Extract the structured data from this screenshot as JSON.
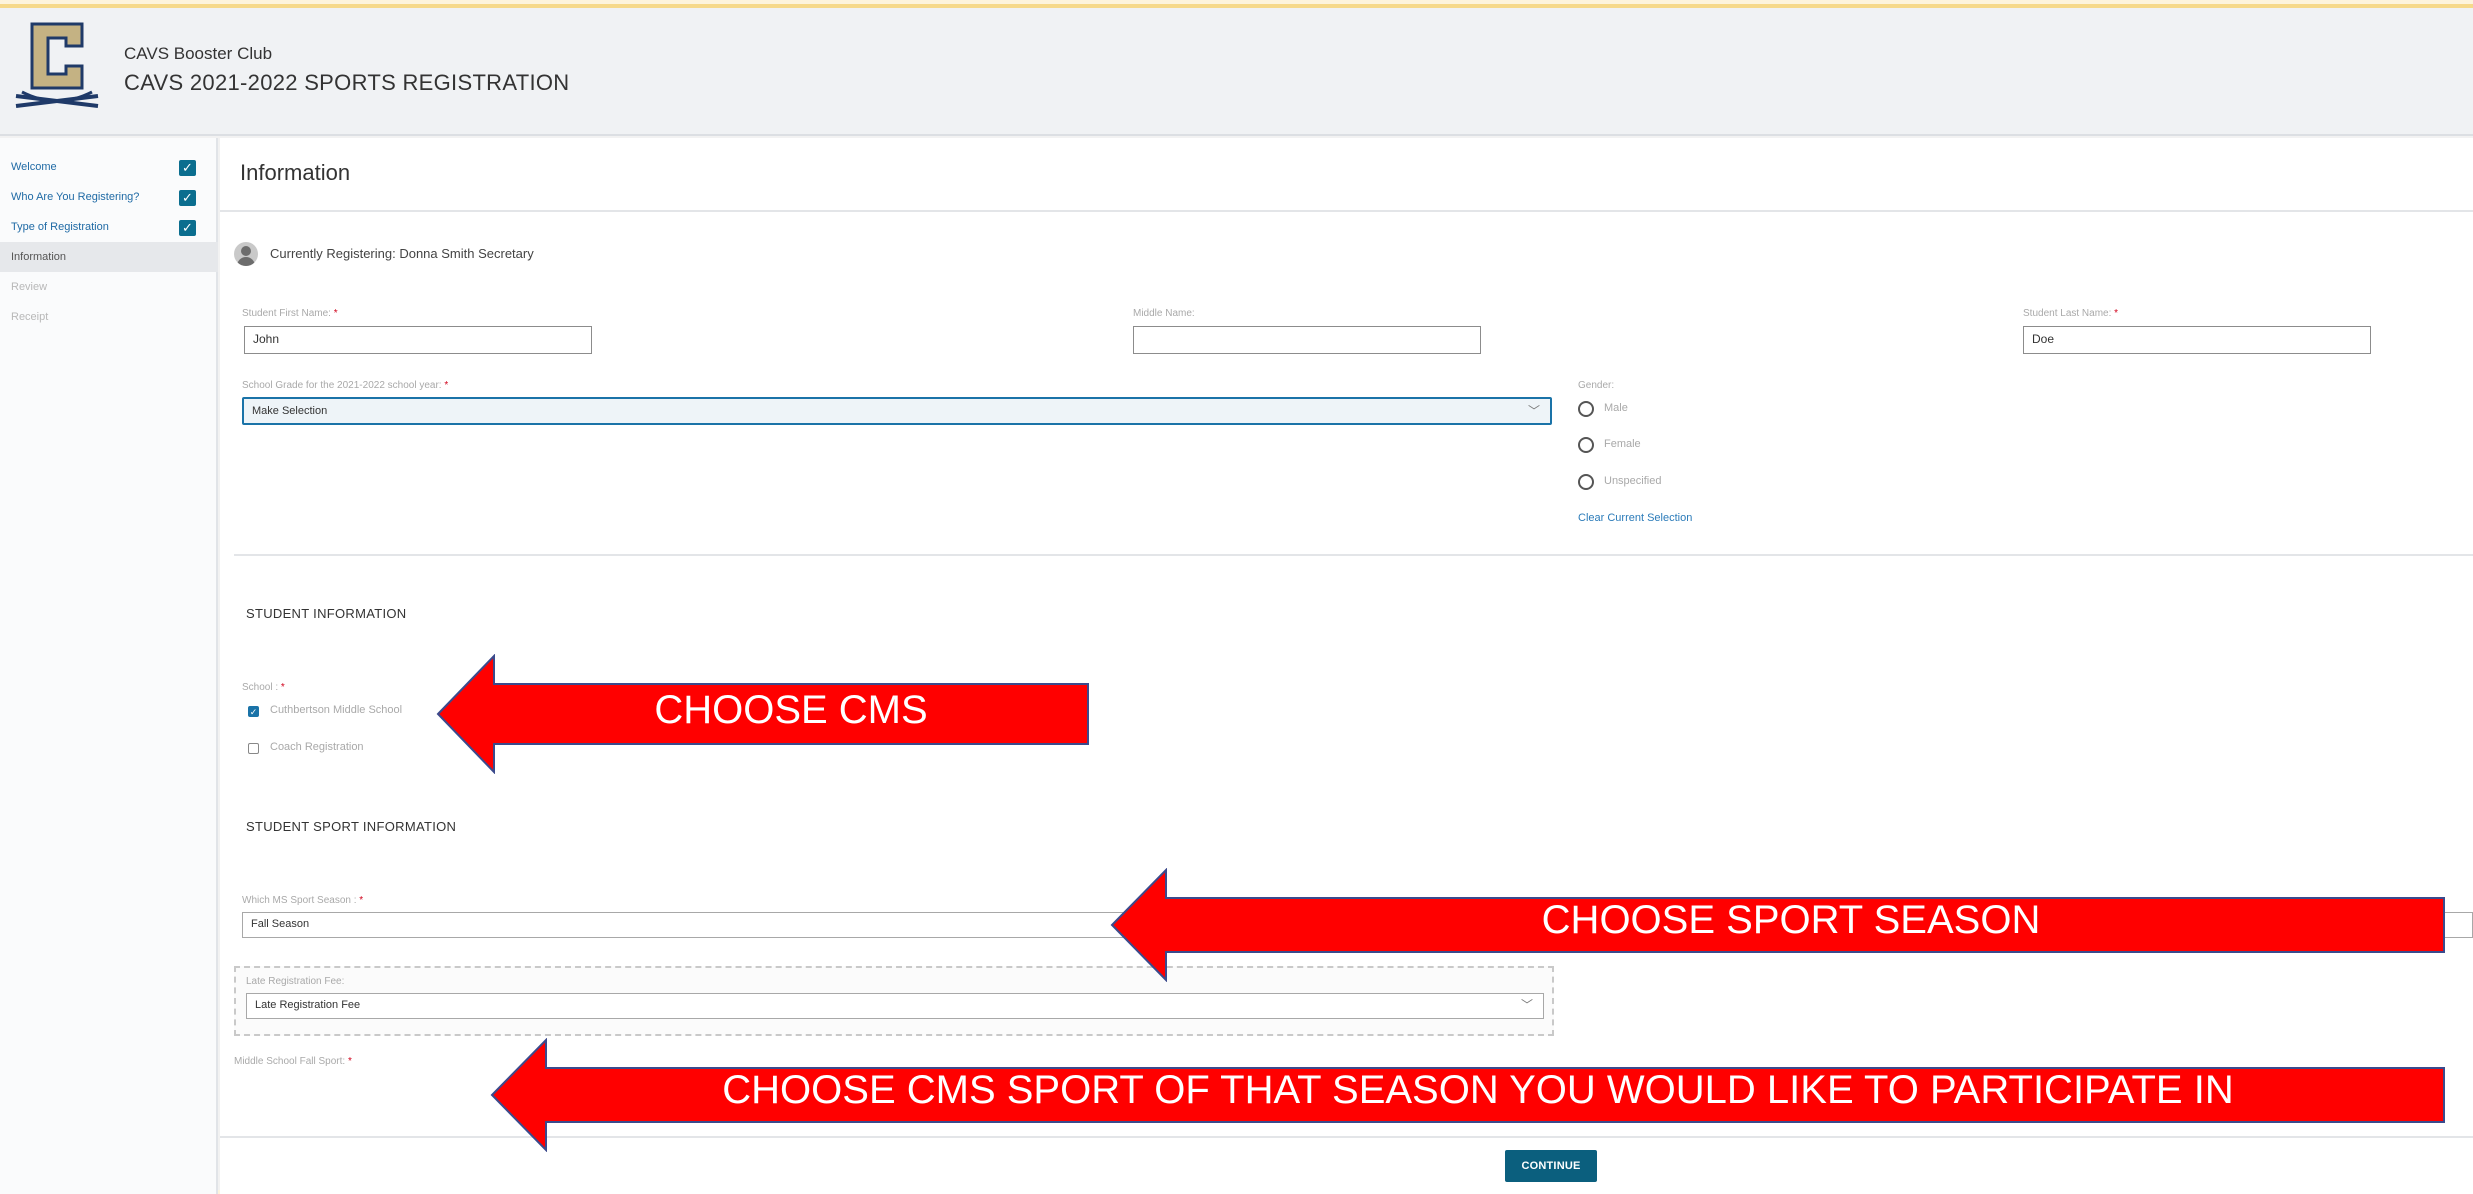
{
  "header": {
    "org_name": "CAVS Booster Club",
    "event_name": "CAVS 2021-2022 SPORTS REGISTRATION"
  },
  "sidebar": {
    "steps": [
      {
        "label": "Welcome",
        "state": "done"
      },
      {
        "label": "Who Are You Registering?",
        "state": "done"
      },
      {
        "label": "Type of Registration",
        "state": "done"
      },
      {
        "label": "Information",
        "state": "active"
      },
      {
        "label": "Review",
        "state": "todo"
      },
      {
        "label": "Receipt",
        "state": "todo"
      }
    ]
  },
  "main": {
    "title": "Information",
    "currently_registering": "Currently Registering: Donna Smith Secretary",
    "fields": {
      "first_name_label": "Student First Name:",
      "first_name_value": "John",
      "middle_name_label": "Middle Name:",
      "middle_name_value": "",
      "last_name_label": "Student Last Name:",
      "last_name_value": "Doe",
      "grade_label": "School Grade for the 2021-2022 school year:",
      "grade_value": "Make Selection",
      "gender_label": "Gender:",
      "gender_options": [
        "Male",
        "Female",
        "Unspecified"
      ],
      "clear_selection": "Clear Current Selection",
      "required_mark": "*"
    },
    "student_info": {
      "heading": "STUDENT INFORMATION",
      "school_label": "School :",
      "schools": [
        {
          "label": "Cuthbertson Middle School",
          "checked": true
        },
        {
          "label": "Coach Registration",
          "checked": false
        }
      ]
    },
    "sport_info": {
      "heading": "STUDENT SPORT INFORMATION",
      "season_label": "Which MS Sport Season :",
      "season_value": "Fall Season",
      "late_fee_label": "Late Registration Fee:",
      "late_fee_value": "Late Registration Fee",
      "fall_sport_label": "Middle School Fall Sport:"
    }
  },
  "footer": {
    "continue_label": "CONTINUE"
  },
  "annotations": {
    "arrow1": "CHOOSE CMS",
    "arrow2": "CHOOSE SPORT SEASON",
    "arrow3": "CHOOSE CMS SPORT OF THAT SEASON YOU WOULD LIKE TO PARTICIPATE IN",
    "arrow_color": "#ff0000"
  },
  "colors": {
    "accent": "#0b6e8f",
    "link": "#2b7bb9",
    "required": "#d0021b"
  }
}
